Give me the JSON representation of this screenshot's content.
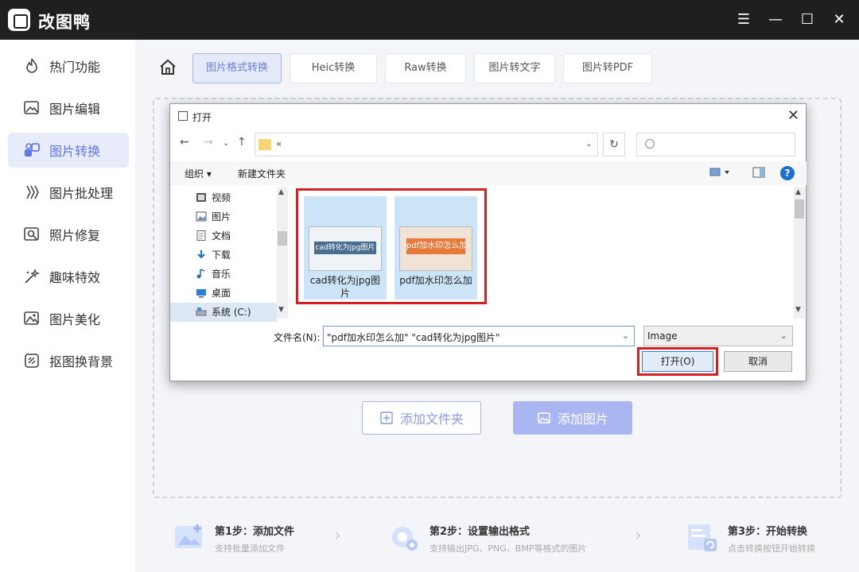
{
  "app": {
    "title": "改图鸭"
  },
  "window_controls": {
    "menu": "☰",
    "minimize": "—",
    "maximize": "☐",
    "close": "✕"
  },
  "sidebar": {
    "items": [
      {
        "label": "热门功能",
        "icon": "flame-icon"
      },
      {
        "label": "图片编辑",
        "icon": "image-edit-icon"
      },
      {
        "label": "图片转换",
        "icon": "convert-icon",
        "active": true
      },
      {
        "label": "图片批处理",
        "icon": "batch-icon"
      },
      {
        "label": "照片修复",
        "icon": "photo-repair-icon"
      },
      {
        "label": "趣味特效",
        "icon": "magic-wand-icon"
      },
      {
        "label": "图片美化",
        "icon": "beautify-icon"
      },
      {
        "label": "抠图换背景",
        "icon": "cutout-icon"
      }
    ]
  },
  "tabs": [
    {
      "label": "图片格式转换",
      "active": true
    },
    {
      "label": "Heic转换"
    },
    {
      "label": "Raw转换"
    },
    {
      "label": "图片转文字"
    },
    {
      "label": "图片转PDF"
    }
  ],
  "actions": {
    "add_folder": "添加文件夹",
    "add_image": "添加图片"
  },
  "steps": [
    {
      "title": "第1步：添加文件",
      "desc": "支持批量添加文件"
    },
    {
      "title": "第2步：设置输出格式",
      "desc": "支持输出JPG、PNG、BMP等格式的图片"
    },
    {
      "title": "第3步：开始转换",
      "desc": "点击转换按钮开始转换"
    }
  ],
  "dialog": {
    "title": "打开",
    "path": "«",
    "toolbar": {
      "organize": "组织 ▾",
      "new_folder": "新建文件夹"
    },
    "nav_items": [
      {
        "label": "视频"
      },
      {
        "label": "图片"
      },
      {
        "label": "文档"
      },
      {
        "label": "下载"
      },
      {
        "label": "音乐"
      },
      {
        "label": "桌面"
      },
      {
        "label": "系统 (C:)",
        "selected": true
      }
    ],
    "files": [
      {
        "name": "cad转化为jpg图片",
        "thumb_text": "cad转化为jpg图片"
      },
      {
        "name": "pdf加水印怎么加",
        "thumb_text": "pdf加水印怎么加"
      }
    ],
    "filename_label": "文件名(N):",
    "filename_value": "\"pdf加水印怎么加\" \"cad转化为jpg图片\"",
    "filetype": "Image",
    "open_button": "打开(O)",
    "cancel_button": "取消"
  }
}
